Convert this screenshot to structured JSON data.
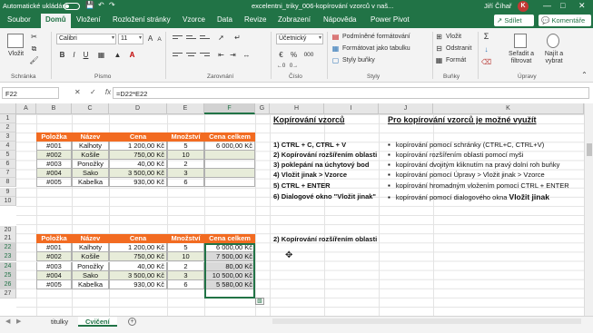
{
  "titlebar": {
    "autosave_label": "Automatické ukládání",
    "toggle_state": "off",
    "document_title": "excelentni_triky_006-kopírování vzorců v naš...",
    "user_name": "Jiří Číhař",
    "user_initial": "K",
    "window_controls": [
      "—",
      "□",
      "✕"
    ]
  },
  "tabs": {
    "items": [
      "Soubor",
      "Domů",
      "Vložení",
      "Rozložení stránky",
      "Vzorce",
      "Data",
      "Revize",
      "Zobrazení",
      "Nápověda",
      "Power Pivot"
    ],
    "active": "Domů",
    "share_label": "Sdílet",
    "comments_label": "Komentáře"
  },
  "ribbon": {
    "clipboard": {
      "paste_label": "Vložit",
      "group_label": "Schránka"
    },
    "font": {
      "font_name": "Calibri",
      "font_size": "11",
      "bold": "B",
      "italic": "I",
      "underline": "U",
      "group_label": "Písmo"
    },
    "alignment": {
      "group_label": "Zarovnání"
    },
    "number": {
      "format": "Účetnický",
      "group_label": "Číslo",
      "percent": "%",
      "thousands": "000"
    },
    "styles": {
      "conditional": "Podmíněné formátování",
      "as_table": "Formátovat jako tabulku",
      "cell_styles": "Styly buňky",
      "group_label": "Styly"
    },
    "cells": {
      "insert": "Vložit",
      "delete": "Odstranit",
      "format": "Formát",
      "group_label": "Buňky"
    },
    "editing": {
      "sort_filter": "Seřadit a filtrovat",
      "find_select": "Najít a vybrat",
      "group_label": "Úpravy"
    },
    "autosum": "Σ"
  },
  "formula_bar": {
    "name_box": "F22",
    "formula": "=D22*E22",
    "cancel": "✕",
    "enter": "✓",
    "fx": "fx"
  },
  "grid": {
    "columns": [
      "A",
      "B",
      "C",
      "D",
      "E",
      "F",
      "G",
      "H",
      "I",
      "J",
      "K"
    ],
    "selected_column": "F",
    "rows": [
      "1",
      "2",
      "3",
      "4",
      "5",
      "6",
      "7",
      "8",
      "9",
      "10",
      "20",
      "21",
      "22",
      "23",
      "24",
      "25",
      "26",
      "27"
    ],
    "selected_rows": [
      "22",
      "23",
      "24",
      "25",
      "26"
    ]
  },
  "table1": {
    "headers": [
      "Položka",
      "Název",
      "Cena",
      "Množství",
      "Cena celkem"
    ],
    "rows": [
      [
        "#001",
        "Kalhoty",
        "1 200,00 Kč",
        "5",
        "6 000,00 Kč"
      ],
      [
        "#002",
        "Košile",
        "750,00 Kč",
        "10",
        ""
      ],
      [
        "#003",
        "Ponožky",
        "40,00 Kč",
        "2",
        ""
      ],
      [
        "#004",
        "Sako",
        "3 500,00 Kč",
        "3",
        ""
      ],
      [
        "#005",
        "Kabelka",
        "930,00 Kč",
        "6",
        ""
      ]
    ]
  },
  "table2": {
    "headers": [
      "Položka",
      "Název",
      "Cena",
      "Množství",
      "Cena celkem"
    ],
    "rows": [
      [
        "#001",
        "Kalhoty",
        "1 200,00 Kč",
        "5",
        "6 000,00 Kč"
      ],
      [
        "#002",
        "Košile",
        "750,00 Kč",
        "10",
        "7 500,00 Kč"
      ],
      [
        "#003",
        "Ponožky",
        "40,00 Kč",
        "2",
        "80,00 Kč"
      ],
      [
        "#004",
        "Sako",
        "3 500,00 Kč",
        "3",
        "10 500,00 Kč"
      ],
      [
        "#005",
        "Kabelka",
        "930,00 Kč",
        "6",
        "5 580,00 Kč"
      ]
    ]
  },
  "notes": {
    "title": "Kopírování vzorců",
    "steps": [
      "1) CTRL + C, CTRL + V",
      "2) Kopírování rozšířením oblasti",
      "3) poklepání na úchytový bod",
      "4) Vložit jinak > Vzorce",
      "5) CTRL + ENTER",
      "6) Dialogové okno \"Vložit jinak\""
    ],
    "current_step": "2) Kopírování rozšířením oblasti"
  },
  "ways": {
    "title": "Pro kopírování vzorců je možné využít",
    "items": [
      "kopírování pomocí schránky (CTRL+C, CTRL+V)",
      "kopírování rozšířením oblasti pomocí myši",
      "kopírování dvojitým kliknutím na pravý dolní roh buňky",
      "kopírování pomocí Úpravy > Vložit jinak > Vzorce",
      "kopírování hromadným vložením pomocí CTRL + ENTER",
      "kopírování pomocí dialogového okna"
    ],
    "last_item_emphasis": "Vložit jinak"
  },
  "sheets": {
    "tabs": [
      "titulky",
      "Cvičení"
    ],
    "active": "Cvičení",
    "add": "+"
  },
  "colors": {
    "excel_green": "#217346",
    "header_orange": "#f26b21",
    "band_green": "#e7ecd9",
    "selection_gray": "#d9d9d9"
  }
}
